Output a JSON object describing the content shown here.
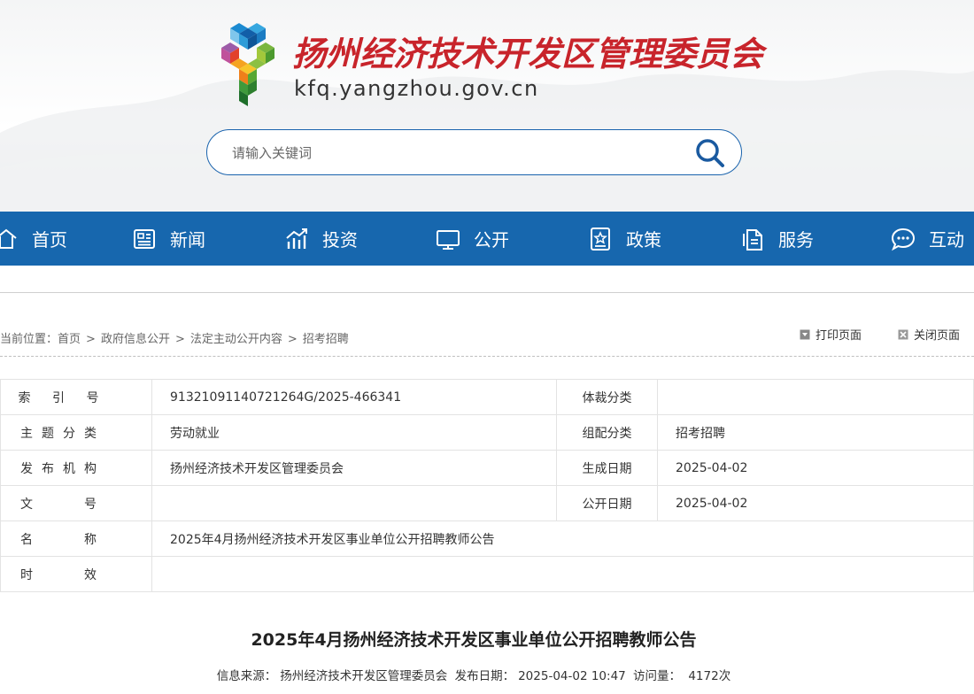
{
  "header": {
    "site_title": "扬州经济技术开发区管理委员会",
    "site_domain": "kfq.yangzhou.gov.cn",
    "search_placeholder": "请输入关键词"
  },
  "nav": [
    {
      "label": "首页",
      "icon": "home-icon"
    },
    {
      "label": "新闻",
      "icon": "newspaper-icon"
    },
    {
      "label": "投资",
      "icon": "growth-chart-icon"
    },
    {
      "label": "公开",
      "icon": "monitor-icon"
    },
    {
      "label": "政策",
      "icon": "policy-star-icon"
    },
    {
      "label": "服务",
      "icon": "document-copy-icon"
    },
    {
      "label": "互动",
      "icon": "chat-bubble-icon"
    }
  ],
  "breadcrumb": {
    "prefix": "当前位置：",
    "items": [
      "首页",
      "政府信息公开",
      "法定主动公开内容",
      "招考招聘"
    ],
    "separator": ">"
  },
  "tools": {
    "print_label": "打印页面",
    "close_label": "关闭页面"
  },
  "info": {
    "rows": [
      {
        "k1": "索 引 号",
        "v1": "91321091140721264G/2025-466341",
        "k2": "体裁分类",
        "v2": ""
      },
      {
        "k1": "主题分类",
        "v1": "劳动就业",
        "k2": "组配分类",
        "v2": "招考招聘"
      },
      {
        "k1": "发布机构",
        "v1": "扬州经济技术开发区管理委员会",
        "k2": "生成日期",
        "v2": "2025-04-02"
      },
      {
        "k1": "文　　号",
        "v1": "",
        "k2": "公开日期",
        "v2": "2025-04-02"
      }
    ],
    "name_label": "名　　称",
    "name_value": "2025年4月扬州经济技术开发区事业单位公开招聘教师公告",
    "validity_label": "时　　效",
    "validity_value": ""
  },
  "article": {
    "title": "2025年4月扬州经济技术开发区事业单位公开招聘教师公告",
    "source_label": "信息来源：",
    "source": "扬州经济技术开发区管理委员会",
    "date_label": "发布日期：",
    "date": "2025-04-02 10:47",
    "views_label": "访问量：",
    "views": "4172次"
  }
}
